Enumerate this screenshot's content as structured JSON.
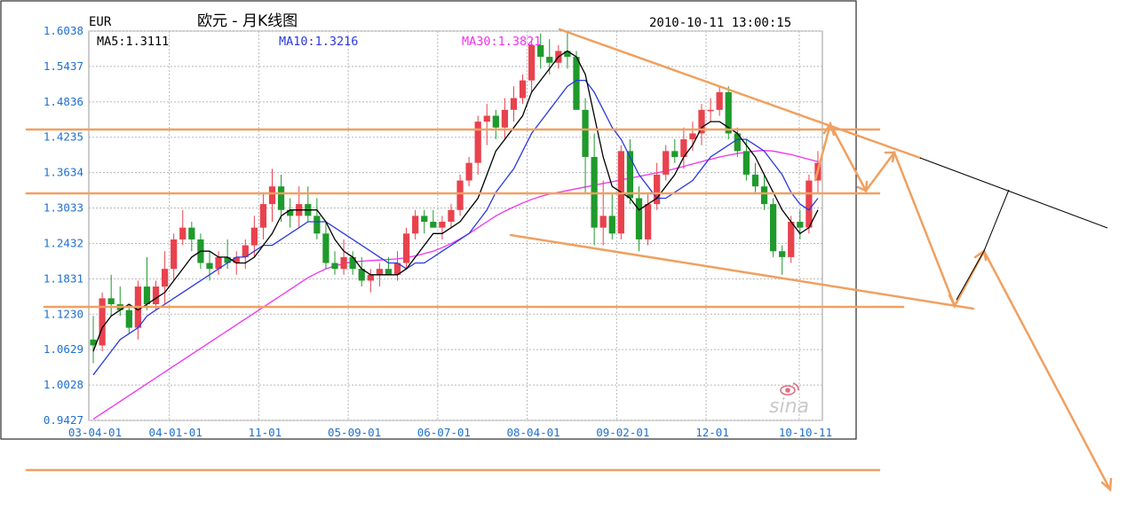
{
  "header": {
    "symbol": "EUR",
    "title": "欧元 - 月K线图",
    "timestamp": "2010-10-11 13:00:15"
  },
  "legend": {
    "ma5": "MA5:1.3111",
    "ma10": "MA10:1.3216",
    "ma30": "MA30:1.3821"
  },
  "brand": "sina",
  "colors": {
    "up": "#e8424e",
    "down": "#1f9a2c",
    "ma5": "#000000",
    "ma10": "#2a39e0",
    "ma30": "#ee33ee",
    "grid": "#b8b8b8",
    "axis_text": "#1e6fd0",
    "annotation": "#f0a060"
  },
  "chart_data": {
    "type": "candlestick",
    "title": "欧元 - 月K线图",
    "y_ticks": [
      "1.6038",
      "1.5437",
      "1.4836",
      "1.4235",
      "1.3634",
      "1.3033",
      "1.2432",
      "1.1831",
      "1.1230",
      "1.0629",
      "1.0028",
      "0.9427"
    ],
    "ylim": [
      0.9427,
      1.6038
    ],
    "x_ticks": [
      "03-04-01",
      "04-01-01",
      "11-01",
      "05-09-01",
      "06-07-01",
      "08-04-01",
      "09-02-01",
      "12-01",
      "10-10-11"
    ],
    "x_tick_month_index": [
      0,
      9,
      19,
      29,
      39,
      49,
      59,
      69,
      79
    ],
    "grid": true,
    "candles": [
      [
        1.08,
        1.12,
        1.04,
        1.07
      ],
      [
        1.07,
        1.16,
        1.06,
        1.15
      ],
      [
        1.15,
        1.19,
        1.12,
        1.14
      ],
      [
        1.14,
        1.17,
        1.12,
        1.13
      ],
      [
        1.13,
        1.14,
        1.09,
        1.1
      ],
      [
        1.1,
        1.18,
        1.08,
        1.17
      ],
      [
        1.17,
        1.22,
        1.13,
        1.14
      ],
      [
        1.14,
        1.18,
        1.13,
        1.17
      ],
      [
        1.17,
        1.23,
        1.14,
        1.2
      ],
      [
        1.2,
        1.26,
        1.18,
        1.25
      ],
      [
        1.25,
        1.3,
        1.24,
        1.27
      ],
      [
        1.27,
        1.28,
        1.23,
        1.25
      ],
      [
        1.25,
        1.26,
        1.2,
        1.21
      ],
      [
        1.21,
        1.23,
        1.18,
        1.2
      ],
      [
        1.2,
        1.23,
        1.19,
        1.22
      ],
      [
        1.22,
        1.25,
        1.2,
        1.21
      ],
      [
        1.21,
        1.23,
        1.19,
        1.22
      ],
      [
        1.22,
        1.25,
        1.2,
        1.24
      ],
      [
        1.24,
        1.29,
        1.22,
        1.27
      ],
      [
        1.27,
        1.33,
        1.25,
        1.31
      ],
      [
        1.31,
        1.37,
        1.28,
        1.34
      ],
      [
        1.34,
        1.36,
        1.28,
        1.3
      ],
      [
        1.3,
        1.32,
        1.27,
        1.29
      ],
      [
        1.29,
        1.34,
        1.27,
        1.31
      ],
      [
        1.31,
        1.34,
        1.28,
        1.29
      ],
      [
        1.29,
        1.32,
        1.25,
        1.26
      ],
      [
        1.26,
        1.28,
        1.2,
        1.21
      ],
      [
        1.21,
        1.23,
        1.19,
        1.2
      ],
      [
        1.2,
        1.25,
        1.19,
        1.22
      ],
      [
        1.22,
        1.23,
        1.19,
        1.2
      ],
      [
        1.2,
        1.22,
        1.17,
        1.18
      ],
      [
        1.18,
        1.2,
        1.16,
        1.19
      ],
      [
        1.19,
        1.21,
        1.17,
        1.2
      ],
      [
        1.2,
        1.22,
        1.19,
        1.19
      ],
      [
        1.19,
        1.23,
        1.18,
        1.21
      ],
      [
        1.21,
        1.27,
        1.2,
        1.26
      ],
      [
        1.26,
        1.3,
        1.25,
        1.29
      ],
      [
        1.29,
        1.3,
        1.26,
        1.28
      ],
      [
        1.28,
        1.3,
        1.27,
        1.27
      ],
      [
        1.27,
        1.29,
        1.25,
        1.28
      ],
      [
        1.28,
        1.31,
        1.27,
        1.3
      ],
      [
        1.3,
        1.36,
        1.29,
        1.35
      ],
      [
        1.35,
        1.39,
        1.34,
        1.38
      ],
      [
        1.38,
        1.46,
        1.36,
        1.45
      ],
      [
        1.45,
        1.48,
        1.41,
        1.46
      ],
      [
        1.46,
        1.47,
        1.42,
        1.44
      ],
      [
        1.44,
        1.49,
        1.42,
        1.47
      ],
      [
        1.47,
        1.51,
        1.45,
        1.49
      ],
      [
        1.49,
        1.53,
        1.48,
        1.52
      ],
      [
        1.52,
        1.59,
        1.5,
        1.58
      ],
      [
        1.58,
        1.6,
        1.54,
        1.56
      ],
      [
        1.56,
        1.59,
        1.53,
        1.55
      ],
      [
        1.55,
        1.58,
        1.54,
        1.57
      ],
      [
        1.57,
        1.6,
        1.54,
        1.56
      ],
      [
        1.56,
        1.57,
        1.49,
        1.47
      ],
      [
        1.47,
        1.49,
        1.33,
        1.39
      ],
      [
        1.39,
        1.43,
        1.24,
        1.27
      ],
      [
        1.27,
        1.35,
        1.24,
        1.29
      ],
      [
        1.29,
        1.33,
        1.25,
        1.26
      ],
      [
        1.26,
        1.41,
        1.25,
        1.4
      ],
      [
        1.4,
        1.42,
        1.31,
        1.32
      ],
      [
        1.32,
        1.34,
        1.23,
        1.25
      ],
      [
        1.25,
        1.33,
        1.24,
        1.31
      ],
      [
        1.31,
        1.38,
        1.3,
        1.36
      ],
      [
        1.36,
        1.41,
        1.35,
        1.4
      ],
      [
        1.4,
        1.42,
        1.38,
        1.39
      ],
      [
        1.39,
        1.44,
        1.37,
        1.42
      ],
      [
        1.42,
        1.45,
        1.4,
        1.43
      ],
      [
        1.43,
        1.48,
        1.41,
        1.47
      ],
      [
        1.47,
        1.49,
        1.45,
        1.47
      ],
      [
        1.47,
        1.51,
        1.46,
        1.5
      ],
      [
        1.5,
        1.51,
        1.42,
        1.43
      ],
      [
        1.43,
        1.44,
        1.39,
        1.4
      ],
      [
        1.4,
        1.42,
        1.35,
        1.36
      ],
      [
        1.36,
        1.38,
        1.33,
        1.34
      ],
      [
        1.34,
        1.36,
        1.3,
        1.31
      ],
      [
        1.31,
        1.32,
        1.22,
        1.23
      ],
      [
        1.23,
        1.24,
        1.19,
        1.22
      ],
      [
        1.22,
        1.29,
        1.21,
        1.28
      ],
      [
        1.28,
        1.3,
        1.25,
        1.27
      ],
      [
        1.27,
        1.36,
        1.26,
        1.35
      ],
      [
        1.35,
        1.4,
        1.33,
        1.38
      ]
    ],
    "ma5": [
      1.06,
      1.1,
      1.12,
      1.13,
      1.14,
      1.13,
      1.14,
      1.15,
      1.16,
      1.18,
      1.2,
      1.22,
      1.23,
      1.23,
      1.22,
      1.22,
      1.21,
      1.21,
      1.22,
      1.24,
      1.26,
      1.29,
      1.3,
      1.3,
      1.3,
      1.3,
      1.28,
      1.25,
      1.23,
      1.22,
      1.2,
      1.19,
      1.19,
      1.19,
      1.19,
      1.2,
      1.22,
      1.24,
      1.26,
      1.26,
      1.27,
      1.28,
      1.3,
      1.32,
      1.36,
      1.4,
      1.42,
      1.44,
      1.46,
      1.5,
      1.52,
      1.54,
      1.56,
      1.57,
      1.56,
      1.53,
      1.46,
      1.39,
      1.34,
      1.33,
      1.32,
      1.3,
      1.31,
      1.32,
      1.34,
      1.36,
      1.39,
      1.41,
      1.44,
      1.45,
      1.45,
      1.44,
      1.43,
      1.41,
      1.39,
      1.36,
      1.33,
      1.3,
      1.28,
      1.26,
      1.27,
      1.3
    ],
    "ma10": [
      1.02,
      1.04,
      1.06,
      1.08,
      1.09,
      1.1,
      1.12,
      1.13,
      1.14,
      1.15,
      1.16,
      1.17,
      1.18,
      1.19,
      1.2,
      1.21,
      1.22,
      1.22,
      1.23,
      1.24,
      1.24,
      1.25,
      1.26,
      1.27,
      1.28,
      1.28,
      1.28,
      1.27,
      1.26,
      1.25,
      1.24,
      1.23,
      1.22,
      1.21,
      1.21,
      1.2,
      1.21,
      1.21,
      1.22,
      1.23,
      1.24,
      1.25,
      1.26,
      1.28,
      1.3,
      1.33,
      1.35,
      1.37,
      1.4,
      1.43,
      1.45,
      1.47,
      1.49,
      1.51,
      1.52,
      1.52,
      1.5,
      1.47,
      1.44,
      1.42,
      1.39,
      1.36,
      1.34,
      1.32,
      1.32,
      1.33,
      1.34,
      1.35,
      1.37,
      1.39,
      1.4,
      1.41,
      1.42,
      1.42,
      1.41,
      1.4,
      1.38,
      1.36,
      1.33,
      1.31,
      1.3,
      1.32
    ],
    "ma30": [
      0.945,
      0.955,
      0.965,
      0.975,
      0.985,
      0.995,
      1.005,
      1.015,
      1.025,
      1.035,
      1.045,
      1.055,
      1.065,
      1.075,
      1.085,
      1.095,
      1.105,
      1.115,
      1.125,
      1.135,
      1.145,
      1.155,
      1.165,
      1.175,
      1.185,
      1.193,
      1.2,
      1.205,
      1.209,
      1.212,
      1.213,
      1.214,
      1.215,
      1.216,
      1.217,
      1.219,
      1.222,
      1.226,
      1.23,
      1.236,
      1.243,
      1.251,
      1.26,
      1.27,
      1.28,
      1.29,
      1.298,
      1.305,
      1.312,
      1.318,
      1.323,
      1.327,
      1.33,
      1.333,
      1.336,
      1.339,
      1.342,
      1.345,
      1.348,
      1.351,
      1.354,
      1.357,
      1.36,
      1.363,
      1.366,
      1.37,
      1.374,
      1.378,
      1.382,
      1.386,
      1.39,
      1.393,
      1.396,
      1.398,
      1.4,
      1.401,
      1.4,
      1.397,
      1.394,
      1.39,
      1.386,
      1.382
    ]
  }
}
